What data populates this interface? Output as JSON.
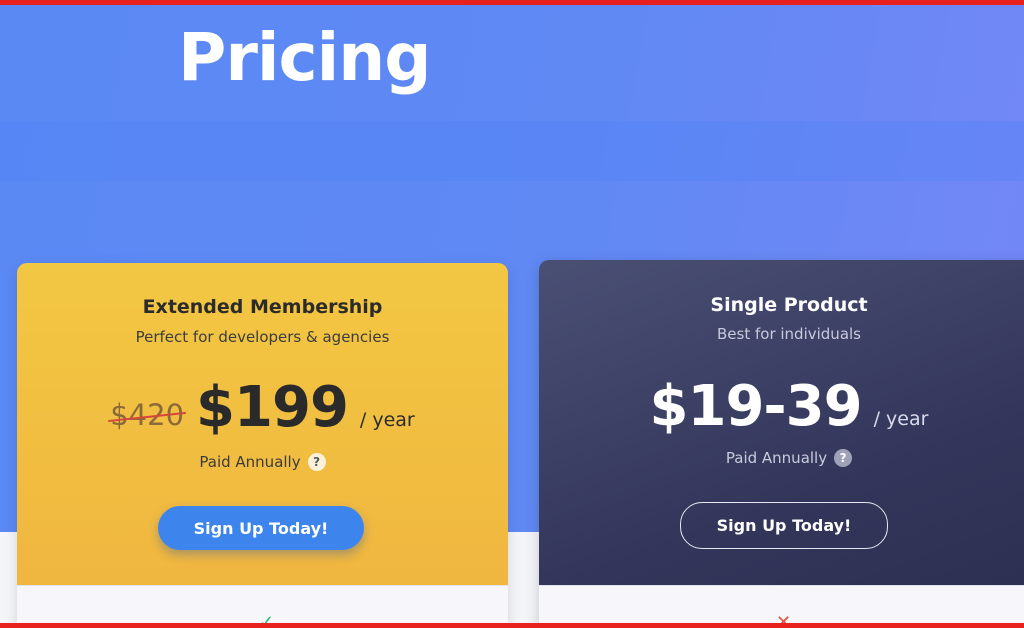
{
  "page": {
    "title": "Pricing"
  },
  "plans": [
    {
      "name": "Extended Membership",
      "subtitle": "Perfect for developers & agencies",
      "old_price": "$420",
      "price": "$199",
      "period": "/ year",
      "billing": "Paid Annually",
      "help": "?",
      "cta": "Sign Up Today!",
      "feature_icon": "check-icon"
    },
    {
      "name": "Single Product",
      "subtitle": "Best for individuals",
      "price": "$19-39",
      "period": "/ year",
      "billing": "Paid Annually",
      "help": "?",
      "cta": "Sign Up Today!",
      "feature_icon": "x-icon"
    }
  ],
  "colors": {
    "hero": "#5a89f4",
    "extended_card": "#f2c742",
    "single_card": "#33365a",
    "primary_button": "#3d85ec",
    "frame": "#e8211f"
  }
}
